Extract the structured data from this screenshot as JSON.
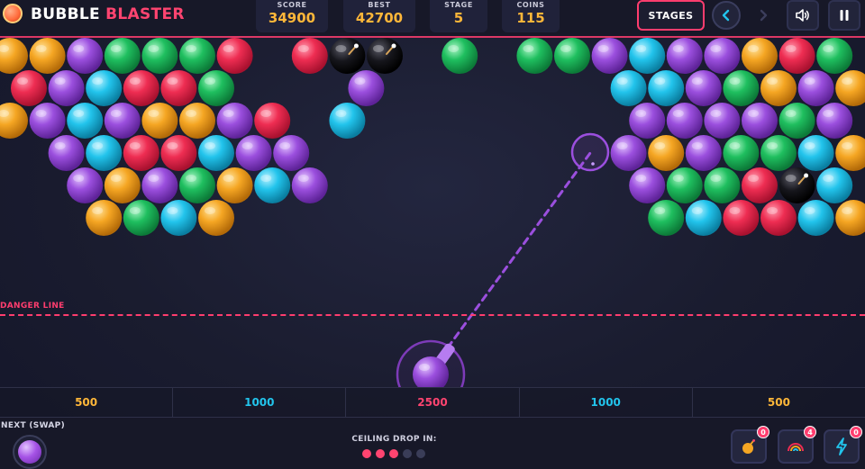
{
  "header": {
    "brand_word1": "BUBBLE",
    "brand_word2": "BLASTER",
    "stats": [
      {
        "label": "SCORE",
        "value": "34900"
      },
      {
        "label": "BEST",
        "value": "42700"
      },
      {
        "label": "STAGE",
        "value": "5"
      },
      {
        "label": "COINS",
        "value": "115"
      }
    ],
    "stages_label": "STAGES",
    "prev_icon": "chevron-left-icon",
    "next_icon": "chevron-right-icon",
    "sound_icon": "speaker-icon",
    "pause_icon": "pause-icon"
  },
  "colors": {
    "red": "#ee2d52",
    "orange": "#f5a623",
    "purple": "#9b4fde",
    "green": "#1fbf5f",
    "cyan": "#22c4ec",
    "bomb": "#111111",
    "danger": "#ff3d6e",
    "accent": "#ffb739"
  },
  "board": {
    "rows": [
      "O O P G G G R . R B B . G . G G P C P P O R G",
      "R P C R R G . . . P . . . . . . C C P G O P O",
      "O P C P O O P R . C . . . . . . . P P P P G P",
      ". P C R R C P P . . . . . . . . P O P G G C O",
      ". . P O P G O C P . . . . . . . . P G G R B C",
      ". . O G C O . . . . . . . . . . . G C R R C O P"
    ],
    "legend": {
      "R": "red",
      "O": "orange",
      "P": "purple",
      "G": "green",
      "C": "cyan",
      "B": "bomb",
      ".": "empty"
    }
  },
  "danger_label": "DANGER LINE",
  "shooter": {
    "ball_color": "purple",
    "aim_icon": "crosshair-ring"
  },
  "score_zones": [
    {
      "label": "500",
      "color": "#ffb739"
    },
    {
      "label": "1000",
      "color": "#22c4ec"
    },
    {
      "label": "2500",
      "color": "#ff4470"
    },
    {
      "label": "1000",
      "color": "#22c4ec"
    },
    {
      "label": "500",
      "color": "#ffb739"
    }
  ],
  "bottom": {
    "next_label": "NEXT (SWAP)",
    "next_color": "purple",
    "ceiling_label": "CEILING DROP IN:",
    "ceiling_dots_filled": 3,
    "ceiling_dots_total": 5,
    "powerups": [
      {
        "name": "bomb-powerup",
        "icon": "bomb-icon",
        "count": "0"
      },
      {
        "name": "rainbow-powerup",
        "icon": "rainbow-icon",
        "count": "4"
      },
      {
        "name": "lightning-powerup",
        "icon": "lightning-icon",
        "count": "0"
      }
    ]
  }
}
